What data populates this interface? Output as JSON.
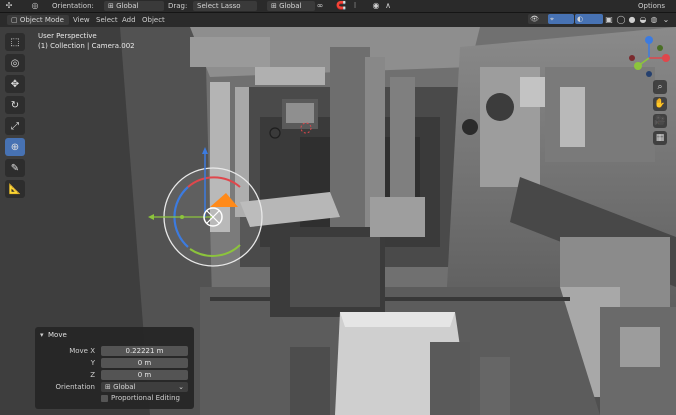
{
  "topbar": {
    "orientation_label": "Orientation:",
    "orientation_value": "Global",
    "drag_label": "Drag:",
    "select_mode": "Select Lasso",
    "pivot_value": "Global",
    "options_label": "Options"
  },
  "header": {
    "mode": "Object Mode",
    "menus": [
      "View",
      "Select",
      "Add",
      "Object"
    ]
  },
  "viewport": {
    "perspective": "User Perspective",
    "collection": "(1) Collection | Camera.002"
  },
  "toolbar": {
    "tools": [
      "select-box",
      "cursor",
      "move",
      "rotate",
      "scale",
      "transform",
      "annotate",
      "measure"
    ],
    "active": "transform"
  },
  "panel": {
    "title": "Move",
    "move_x_label": "Move X",
    "move_x": "0.22221 m",
    "y_label": "Y",
    "y_value": "0 m",
    "z_label": "Z",
    "z_value": "0 m",
    "orientation_label": "Orientation",
    "orientation_value": "Global",
    "proportional_editing": "Proportional Editing"
  },
  "colors": {
    "accent": "#4772b3",
    "x_axis": "#e0474c",
    "y_axis": "#8cc43c",
    "z_axis": "#3c7be0",
    "gizmo_orange": "#ff8a1a"
  }
}
